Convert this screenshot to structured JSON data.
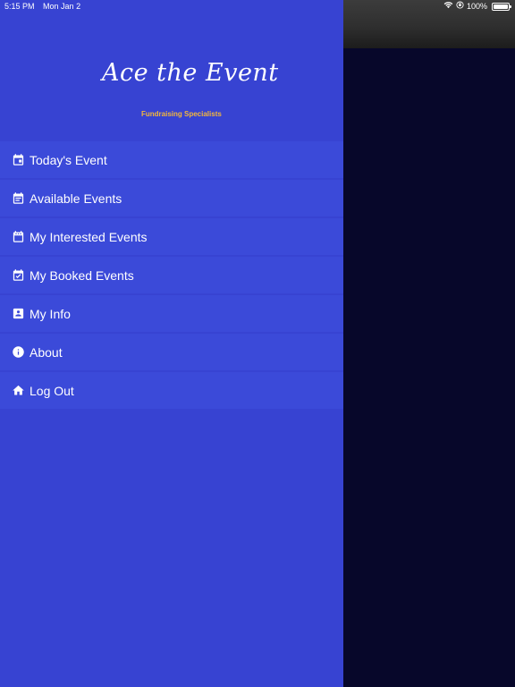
{
  "status_bar": {
    "time": "5:15 PM",
    "date": "Mon Jan 2",
    "battery": "100%",
    "icons": [
      "wifi-icon",
      "orientation-lock-icon",
      "battery-icon"
    ]
  },
  "brand": {
    "logo_text": "Ace the Event",
    "tagline": "Fundraising Specialists",
    "tagline_color": "#f4b73b"
  },
  "colors": {
    "drawer_bg": "#3743d2",
    "menu_item_bg": "#3b4ad9",
    "backdrop": "#07072a"
  },
  "menu": {
    "items": [
      {
        "label": "Today's Event",
        "icon": "calendar-today-icon"
      },
      {
        "label": "Available Events",
        "icon": "calendar-list-icon"
      },
      {
        "label": "My Interested Events",
        "icon": "calendar-dots-icon"
      },
      {
        "label": "My Booked Events",
        "icon": "calendar-check-icon"
      },
      {
        "label": "My Info",
        "icon": "contact-file-icon"
      },
      {
        "label": "About",
        "icon": "info-icon"
      },
      {
        "label": "Log Out",
        "icon": "home-icon"
      }
    ]
  }
}
